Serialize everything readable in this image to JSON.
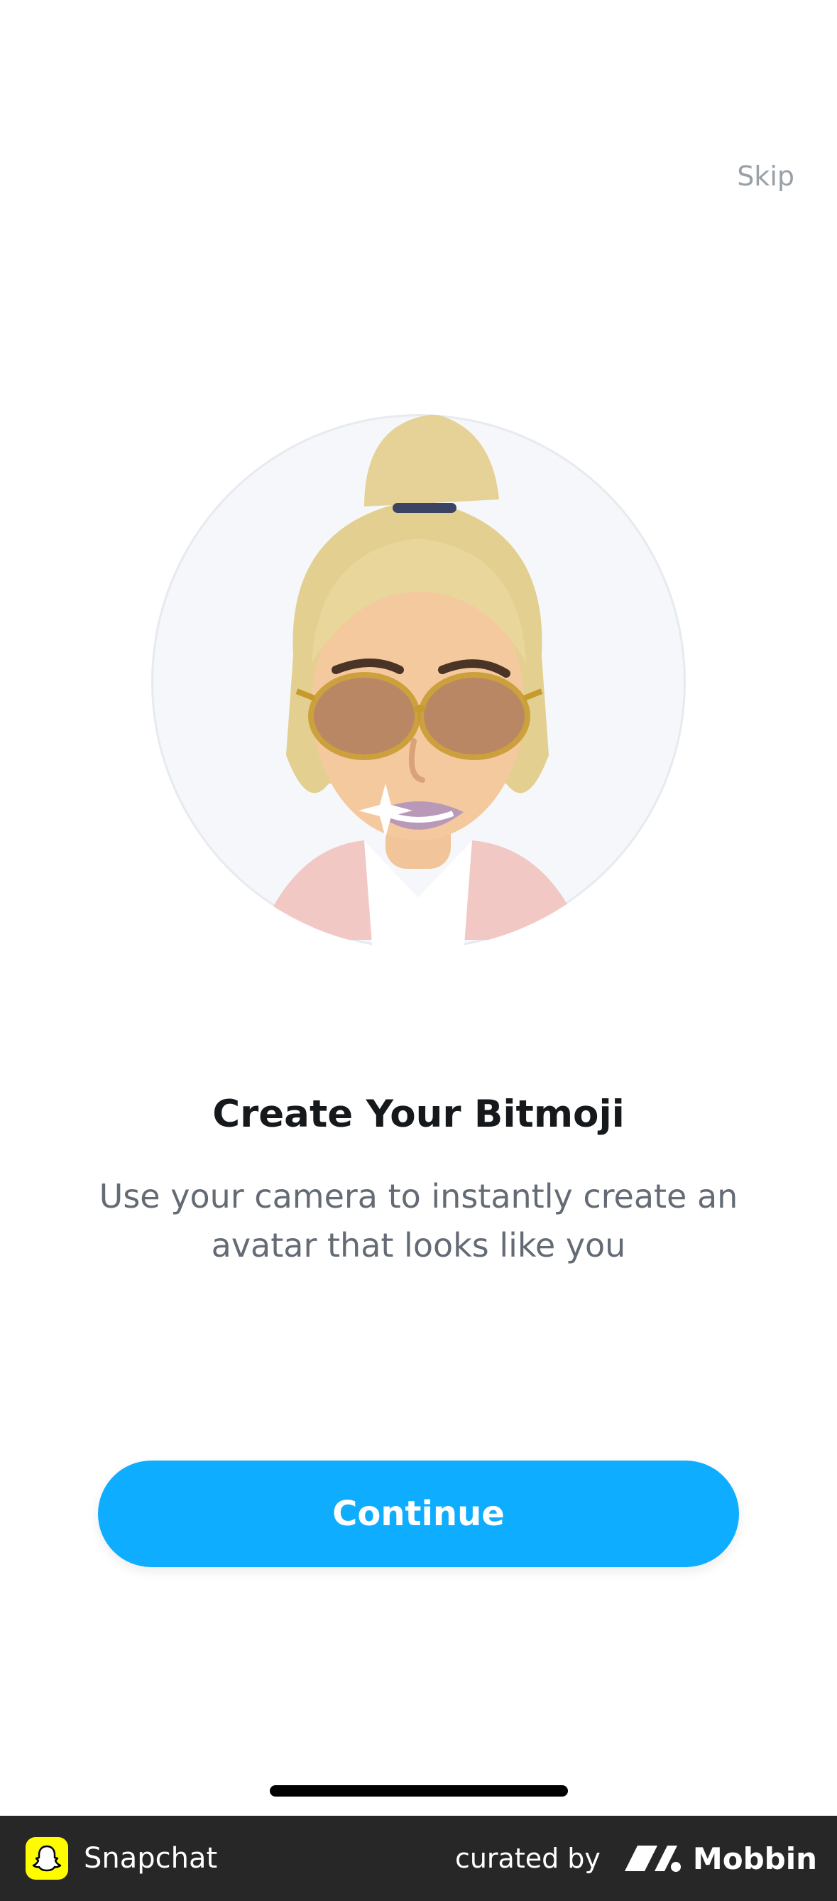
{
  "header": {
    "skip_label": "Skip"
  },
  "main": {
    "avatar_icon": "bitmoji-avatar",
    "title": "Create Your Bitmoji",
    "subtitle": "Use your camera to instantly create an avatar that looks like you",
    "continue_label": "Continue"
  },
  "footer": {
    "app_name": "Snapchat",
    "curated_by": "curated by",
    "brand": "Mobbin"
  },
  "colors": {
    "accent": "#0fadff",
    "title": "#16191c",
    "subtitle": "#646b75",
    "skip": "#9aa0a8",
    "footer_bg": "#272727",
    "snap_yellow": "#fffc00"
  }
}
